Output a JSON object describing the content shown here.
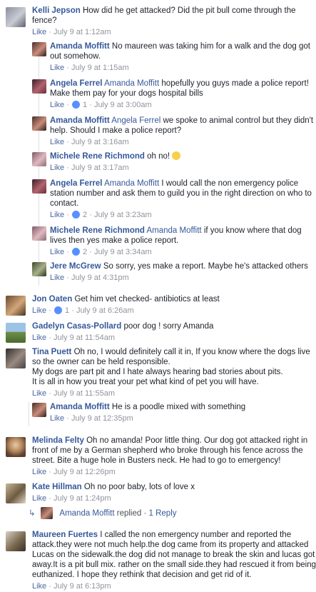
{
  "ui": {
    "like": "Like",
    "dot": " · "
  },
  "comments": [
    {
      "name": "Kelli Jepson",
      "text": "How did he get attacked? Did the pit bull come through the fence?",
      "time": "July 9 at 1:12am"
    },
    {
      "name": "Amanda Moffitt",
      "text": "No maureen was taking him for a walk and the dog got out somehow.",
      "time": "July 9 at 1:15am"
    },
    {
      "name": "Angela Ferrel",
      "tag": "Amanda Moffitt",
      "text": "hopefully you guys made a police report! Make them pay for your dogs hospital bills",
      "time": "July 9 at 3:00am",
      "likes": "1"
    },
    {
      "name": "Amanda Moffitt",
      "tag": "Angela Ferrel",
      "text": "we spoke to animal control but they didn't help. Should I make a police report?",
      "time": "July 9 at 3:16am"
    },
    {
      "name": "Michele Rene Richmond",
      "text": "oh no!",
      "emoji": "sad-face-emoji",
      "time": "July 9 at 3:17am"
    },
    {
      "name": "Angela Ferrel",
      "tag": "Amanda Moffitt",
      "text": "I would call the non emergency police station number and ask them to guild you in the right direction on who to contact.",
      "time": "July 9 at 3:23am",
      "likes": "2"
    },
    {
      "name": "Michele Rene Richmond",
      "tag": "Amanda Moffitt",
      "text": "if you know where that dog lives then yes make a police report.",
      "time": "July 9 at 3:34am",
      "likes": "2"
    },
    {
      "name": "Jere McGrew",
      "text": "So sorry, yes make a report. Maybe he's attacked others",
      "time": "July 9 at 4:31pm"
    },
    {
      "name": "Jon Oaten",
      "text": "Get him vet checked- antibiotics at least",
      "time": "July 9 at 6:26am",
      "likes": "1"
    },
    {
      "name": "Gadelyn Casas-Pollard",
      "text": "poor dog ! sorry Amanda",
      "time": "July 9 at 11:54am"
    },
    {
      "name": "Tina Puett",
      "text": "Oh no, I would definitely call it in, If you know where the dogs live so the owner can be held responsible.",
      "text2": "My dogs are part pit and I hate always hearing bad stories about pits.",
      "text3": "It is all in how you treat your pet what kind of pet you will have.",
      "time": "July 9 at 11:55am"
    },
    {
      "name": "Amanda Moffitt",
      "text": "He is a poodle mixed with something",
      "time": "July 9 at 12:35pm"
    },
    {
      "name": "Melinda Felty",
      "text": "Oh no amanda! Poor little thing. Our dog got attacked right in front of me by a German shepherd who broke through his fence across the street. Bite a huge hole in Busters neck. He had to go to emergency!",
      "time": "July 9 at 12:26pm"
    },
    {
      "name": "Kate Hillman",
      "text": "Oh no poor baby, lots of love x",
      "time": "July 9 at 1:24pm"
    },
    {
      "name": "Maureen Fuertes",
      "text": "I called the non emergency number and reported the attack.they were not much help.the dog came from its property and attacked Lucas on the sidewalk.the dog did not manage to break the skin and lucas got away.It is a pit bull mix. rather on the small side.they had rescued it from being euthanized. I hope they rethink that decision and get rid of it.",
      "time": "July 9 at 6:13pm"
    }
  ],
  "reply_summary": {
    "name": "Amanda Moffitt",
    "text": "replied",
    "count": "1 Reply"
  },
  "colors": {
    "link": "#365899",
    "meta": "#90949c",
    "like_icon": "#5890ff",
    "divider": "#dddfe2"
  }
}
